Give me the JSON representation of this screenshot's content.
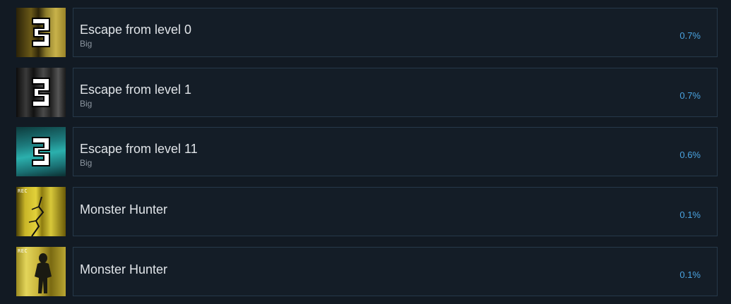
{
  "achievements": [
    {
      "title": "Escape from level 0",
      "subtitle": "Big",
      "percent": "0.7%",
      "thumb_icon": "level-badge-3-icon",
      "thumb_text": "3",
      "accent": "#4aa3e0"
    },
    {
      "title": "Escape from level 1",
      "subtitle": "Big",
      "percent": "0.7%",
      "thumb_icon": "level-badge-3-icon",
      "thumb_text": "3",
      "accent": "#4aa3e0"
    },
    {
      "title": "Escape from level 11",
      "subtitle": "Big",
      "percent": "0.6%",
      "thumb_icon": "level-badge-3-icon",
      "thumb_text": "3",
      "accent": "#4aa3e0"
    },
    {
      "title": "Monster Hunter",
      "subtitle": "",
      "percent": "0.1%",
      "thumb_icon": "camera-rec-icon",
      "thumb_text": "REC",
      "accent": "#4aa3e0"
    },
    {
      "title": "Monster Hunter",
      "subtitle": "",
      "percent": "0.1%",
      "thumb_icon": "camera-rec-icon",
      "thumb_text": "REC",
      "accent": "#4aa3e0"
    }
  ],
  "colors": {
    "background": "#121a23",
    "card": "#141d27",
    "border": "#26394a",
    "title": "#e0e4e8",
    "subtitle": "#8c96a0",
    "percent": "#4aa3e0"
  }
}
